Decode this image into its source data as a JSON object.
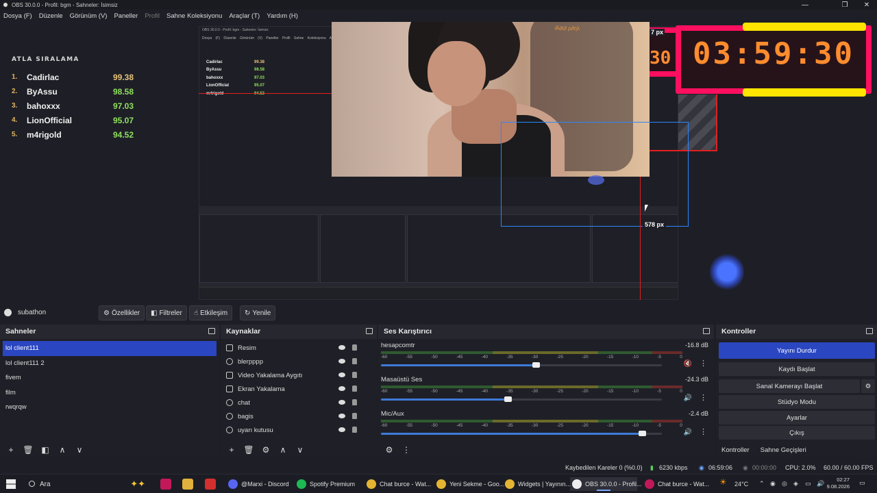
{
  "window": {
    "title": "OBS 30.0.0 - Profil: bgm - Sahneler: İsimsiz",
    "controls": [
      "—",
      "❐",
      "✕"
    ]
  },
  "menu": {
    "items": [
      "Dosya (F)",
      "Düzenle",
      "Görünüm (V)",
      "Paneller",
      "Profil",
      "Sahne Koleksiyonu",
      "Araçlar (T)",
      "Yardım (H)"
    ]
  },
  "preview": {
    "leaderboard": {
      "title": "ATLA SIRALAMA",
      "rows": [
        {
          "rank": "1.",
          "name": "Cadirlac",
          "score": "99.38"
        },
        {
          "rank": "2.",
          "name": "ByAssu",
          "score": "98.58"
        },
        {
          "rank": "3.",
          "name": "bahoxxx",
          "score": "97.03"
        },
        {
          "rank": "4.",
          "name": "LionOfficial",
          "score": "95.07"
        },
        {
          "rank": "5.",
          "name": "m4rigold",
          "score": "94.52"
        }
      ]
    },
    "timer": "03:59:30",
    "timer_partial": "30",
    "px_top": "7 px",
    "px_label": "578 px",
    "cam_text": "ॐ∂ℓ∂ ρ∂ηλ",
    "inner_title": "OBS 30.0.0 - Profil: bgm - Sahneler: İsimsiz",
    "inner_menu": "Dosya (F) Düzenle Görünüm (V) Paneller Profil Sahne Koleksiyonu Araçlar (T) Yardım (H)"
  },
  "source_toolbar": {
    "source_name": "subathon",
    "properties": "Özellikler",
    "filters": "Filtreler",
    "interact": "Etkileşim",
    "refresh": "Yenile"
  },
  "scenes": {
    "title": "Sahneler",
    "items": [
      "lol client111",
      "lol client111 2",
      "fivem",
      "film",
      "rwqrqw"
    ],
    "selected": "lol client111"
  },
  "sources": {
    "title": "Kaynaklar",
    "items": [
      "Resim",
      "blerpppp",
      "Video Yakalama Aygıtı",
      "Ekran Yakalama",
      "chat",
      "bagis",
      "uyarı kutusu"
    ]
  },
  "mixer": {
    "title": "Ses Karıştırıcı",
    "ticks": [
      "-60",
      "-55",
      "-50",
      "-45",
      "-40",
      "-35",
      "-30",
      "-25",
      "-20",
      "-15",
      "-10",
      "-5",
      "0"
    ],
    "channels": [
      {
        "name": "hesapcomtr",
        "db": "-16.8 dB",
        "level": 0.55,
        "muted": true
      },
      {
        "name": "Masaüstü Ses",
        "db": "-24.3 dB",
        "level": 0.45,
        "muted": false
      },
      {
        "name": "Mic/Aux",
        "db": "-2.4 dB",
        "level": 0.93,
        "muted": false
      }
    ]
  },
  "controls": {
    "title": "Kontroller",
    "stop_stream": "Yayını Durdur",
    "start_record": "Kaydı Başlat",
    "start_virtualcam": "Sanal Kamerayı Başlat",
    "studio_mode": "Stüdyo Modu",
    "settings": "Ayarlar",
    "exit": "Çıkış",
    "tab_controls": "Kontroller",
    "tab_transitions": "Sahne Geçişleri"
  },
  "status": {
    "dropped": "Kaybedilen Kareler 0 (%0.0)",
    "bitrate": "6230 kbps",
    "stream_time": "06:59:06",
    "rec_time": "00:00:00",
    "cpu": "CPU: 2.0%",
    "fps": "60.00 / 60.00 FPS"
  },
  "taskbar": {
    "search": "Ara",
    "apps": [
      {
        "label": "@Marxi - Discord",
        "color": "#5865f2"
      },
      {
        "label": "Spotify Premium",
        "color": "#1db954"
      },
      {
        "label": "Chat burce - Wat...",
        "color": "#e5b532"
      },
      {
        "label": "Yeni Sekme - Goo...",
        "color": "#e5b532"
      },
      {
        "label": "Widgets | Yayının...",
        "color": "#e5b532"
      },
      {
        "label": "OBS 30.0.0 - Profil...",
        "color": "#eeeeee"
      },
      {
        "label": "Chat burce - Wat...",
        "color": "#c2185b"
      }
    ],
    "weather": "24°C",
    "time": "02:27",
    "date": "9.08.2026"
  },
  "colors": {
    "accent": "#2a46c1",
    "timer_border": "#ff0f5f",
    "timer_text": "#ff8c2e",
    "timer_bar": "#ffe400"
  }
}
